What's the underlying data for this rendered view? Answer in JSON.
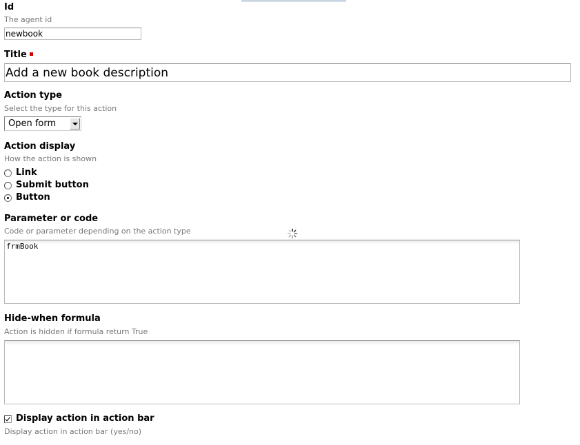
{
  "fields": {
    "id": {
      "label": "Id",
      "help": "The agent id",
      "value": "newbook"
    },
    "title": {
      "label": "Title",
      "value": "Add a new book description"
    },
    "action_type": {
      "label": "Action type",
      "help": "Select the type for this action",
      "selected": "Open form"
    },
    "action_display": {
      "label": "Action display",
      "help": "How the action is shown",
      "options": [
        "Link",
        "Submit button",
        "Button"
      ],
      "selected": "Button"
    },
    "parameter": {
      "label": "Parameter or code",
      "help": "Code or parameter depending on the action type",
      "value": "frmBook"
    },
    "hide_when": {
      "label": "Hide-when formula",
      "help": "Action is hidden if formula return True",
      "value": ""
    },
    "display_in_bar": {
      "label": "Display action in action bar",
      "help": "Display action in action bar (yes/no)",
      "checked": true
    }
  },
  "icons": {
    "required": "required-marker",
    "loading": "spinner-icon",
    "dropdown": "chevron-down-icon"
  },
  "colors": {
    "required": "#cc0000",
    "help_text": "#777777"
  }
}
